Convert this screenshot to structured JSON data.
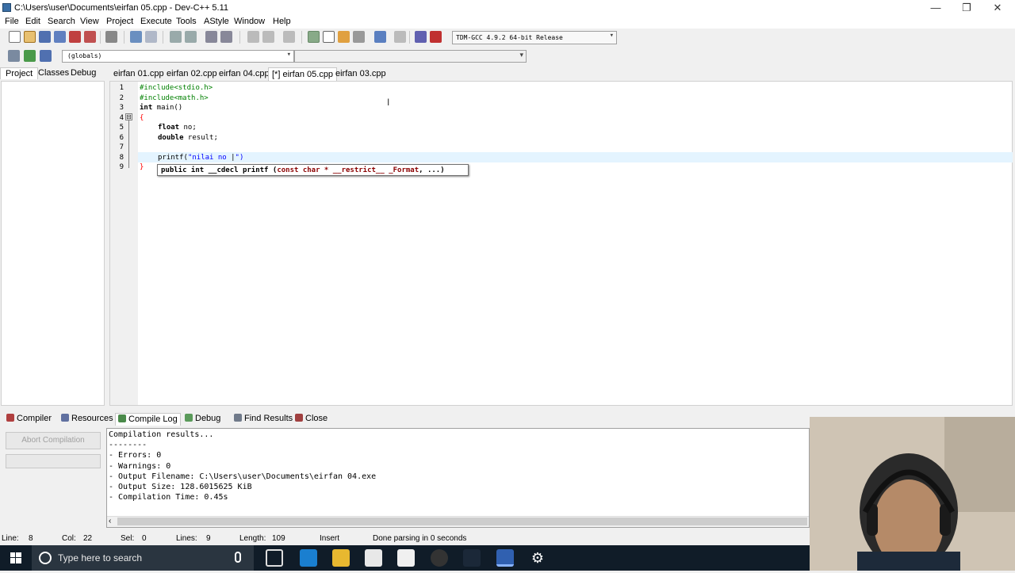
{
  "window": {
    "title": "C:\\Users\\user\\Documents\\eirfan 05.cpp - Dev-C++ 5.11",
    "minimize": "—",
    "restore": "❐",
    "close": "✕"
  },
  "menu": [
    "File",
    "Edit",
    "Search",
    "View",
    "Project",
    "Execute",
    "Tools",
    "AStyle",
    "Window",
    "Help"
  ],
  "toolbar": {
    "compiler": "TDM-GCC 4.9.2 64-bit Release",
    "scope": "(globals)"
  },
  "left_tabs": [
    "Project",
    "Classes",
    "Debug"
  ],
  "file_tabs": [
    "eirfan 01.cpp",
    "eirfan 02.cpp",
    "eirfan 04.cpp",
    "[*] eirfan 05.cpp",
    "eirfan 03.cpp"
  ],
  "editor": {
    "line_numbers": [
      "1",
      "2",
      "3",
      "4",
      "5",
      "6",
      "7",
      "8",
      "9"
    ],
    "code": {
      "l1": "#include<stdio.h>",
      "l2": "#include<math.h>",
      "l3_kw": "int",
      "l3_rest": " main()",
      "l4": "{",
      "l5_kw": "float",
      "l5_rest": " no;",
      "l6_kw": "double",
      "l6_rest": " result;",
      "l8_fn": "printf(",
      "l8_str": "\"nilai no ",
      "l8_cursor": "|",
      "l8_end": "\")",
      "l9": "}"
    },
    "fold_sign": "⊟",
    "tooltip": {
      "part1": "public int __cdecl printf (",
      "part2": "const char * __restrict__ _Format",
      "part3": ", ...)"
    }
  },
  "bottom_tabs": [
    "Compiler",
    "Resources",
    "Compile Log",
    "Debug",
    "Find Results",
    "Close"
  ],
  "abort_button": "Abort Compilation",
  "compile_log": [
    "Compilation results...",
    "--------",
    "- Errors: 0",
    "- Warnings: 0",
    "- Output Filename: C:\\Users\\user\\Documents\\eirfan 04.exe",
    "- Output Size: 128.6015625 KiB",
    "- Compilation Time: 0.45s"
  ],
  "status": {
    "line_label": "Line:",
    "line": "8",
    "col_label": "Col:",
    "col": "22",
    "sel_label": "Sel:",
    "sel": "0",
    "lines_label": "Lines:",
    "lines": "9",
    "length_label": "Length:",
    "length": "109",
    "mode": "Insert",
    "message": "Done parsing in 0 seconds"
  },
  "taskbar": {
    "search_placeholder": "Type here to search"
  },
  "colors": {
    "accent": "#3a6ea5",
    "taskbar": "#101c28",
    "current_line": "#e4f4ff"
  }
}
